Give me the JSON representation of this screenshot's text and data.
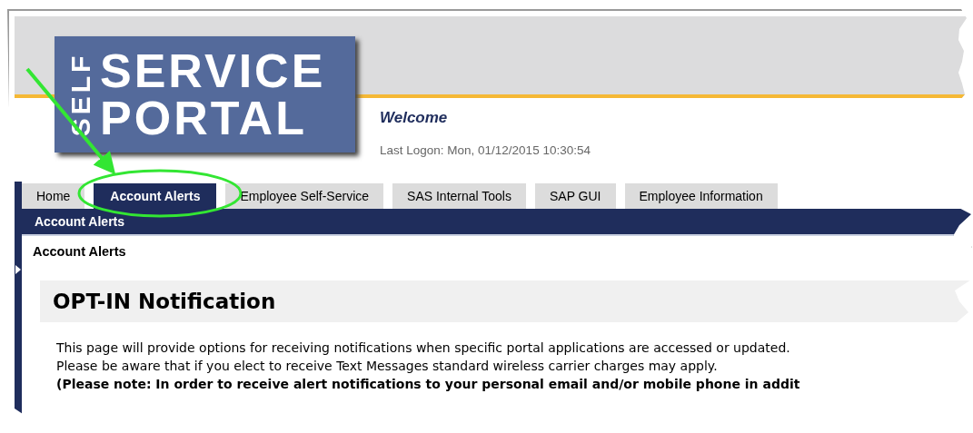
{
  "logo": {
    "side_word": "SELF",
    "top_word": "SERVICE",
    "bottom_word": "PORTAL"
  },
  "welcome": "Welcome",
  "last_logon": "Last Logon: Mon, 01/12/2015 10:30:54",
  "tabs": [
    {
      "label": "Home",
      "selected": false
    },
    {
      "label": "Account Alerts",
      "selected": true
    },
    {
      "label": "Employee Self-Service",
      "selected": false
    },
    {
      "label": "SAS Internal Tools",
      "selected": false
    },
    {
      "label": "SAP GUI",
      "selected": false
    },
    {
      "label": "Employee Information",
      "selected": false
    }
  ],
  "subnav": {
    "label": "Account Alerts"
  },
  "breadcrumb": "Account Alerts",
  "heading": "OPT-IN Notification",
  "paragraphs": [
    {
      "kind": "text",
      "text": "This page will provide options for receiving notifications when specific portal applications are accessed or updated."
    },
    {
      "kind": "text",
      "text": "Please be aware that if you elect to receive Text Messages standard wireless carrier charges may apply."
    },
    {
      "kind": "note",
      "text": "(Please note: In order to receive alert notifications to your personal email and/or mobile phone in addit"
    }
  ]
}
